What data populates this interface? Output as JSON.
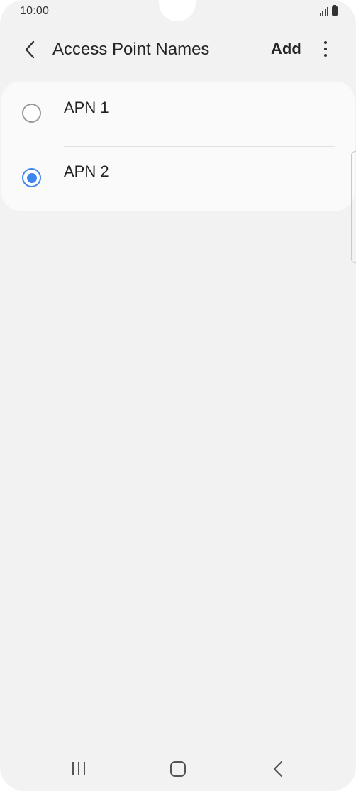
{
  "status_bar": {
    "time": "10:00",
    "signal_icon": "signal-icon",
    "battery_icon": "battery-icon"
  },
  "header": {
    "back_icon": "chevron-left-icon",
    "title": "Access Point Names",
    "add_label": "Add",
    "more_icon": "more-vertical-icon"
  },
  "apn_list": [
    {
      "label": "APN 1",
      "selected": false
    },
    {
      "label": "APN 2",
      "selected": true
    }
  ],
  "nav_bar": {
    "recents_icon": "recents-icon",
    "home_icon": "home-icon",
    "back_icon": "back-chevron-icon"
  },
  "colors": {
    "background": "#f2f2f2",
    "card": "#fafafa",
    "accent": "#3e86ee",
    "text": "#222222"
  }
}
